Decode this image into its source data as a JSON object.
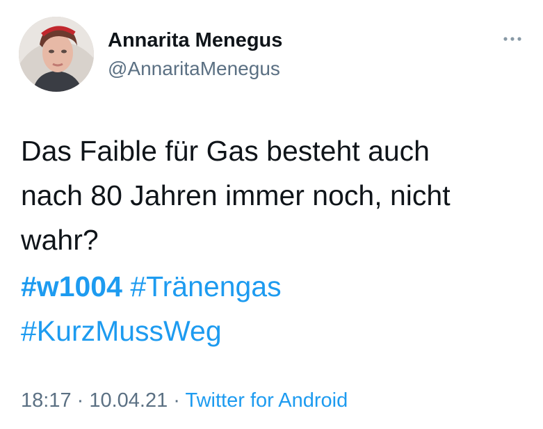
{
  "author": {
    "name": "Annarita Menegus",
    "handle": "@AnnaritaMenegus",
    "avatar_icon": "profile-photo"
  },
  "more_icon": "ellipsis-icon",
  "tweet": {
    "lines": [
      "Das Faible für Gas besteht auch",
      "nach 80 Jahren immer noch, nicht",
      "wahr?"
    ],
    "hashtags": [
      "#w1004",
      "#Tränengas",
      "#KurzMussWeg"
    ]
  },
  "meta": {
    "time": "18:17",
    "separator1": " · ",
    "date": "10.04.21",
    "separator2": " · ",
    "source": "Twitter for Android"
  },
  "colors": {
    "link": "#1d9bf0",
    "secondary_text": "#5b7083",
    "primary_text": "#0f1419"
  }
}
